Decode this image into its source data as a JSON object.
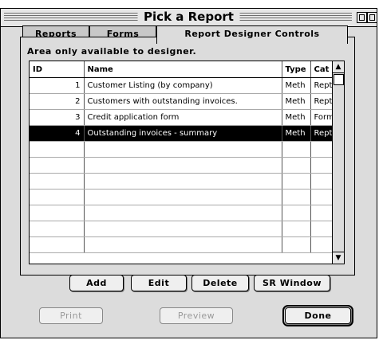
{
  "window": {
    "title": "Pick a Report"
  },
  "tabs": [
    {
      "label": "Reports",
      "active": false
    },
    {
      "label": "Forms",
      "active": false
    },
    {
      "label": "Report Designer Controls",
      "active": true
    }
  ],
  "note": "Area only available to designer.",
  "table": {
    "columns": [
      "ID",
      "Name",
      "Type",
      "Cat"
    ],
    "rows": [
      {
        "id": "1",
        "name": "Customer Listing (by company)",
        "type": "Meth",
        "cat": "Rept",
        "selected": false
      },
      {
        "id": "2",
        "name": "Customers with outstanding invoices.",
        "type": "Meth",
        "cat": "Rept",
        "selected": false
      },
      {
        "id": "3",
        "name": "Credit application form",
        "type": "Meth",
        "cat": "Form",
        "selected": false
      },
      {
        "id": "4",
        "name": "Outstanding invoices - summary",
        "type": "Meth",
        "cat": "Rept",
        "selected": true
      }
    ]
  },
  "buttons": {
    "add": "Add",
    "edit": "Edit",
    "delete": "Delete",
    "sr_window": "SR Window"
  },
  "footer": {
    "print": "Print",
    "preview": "Preview",
    "done": "Done"
  }
}
